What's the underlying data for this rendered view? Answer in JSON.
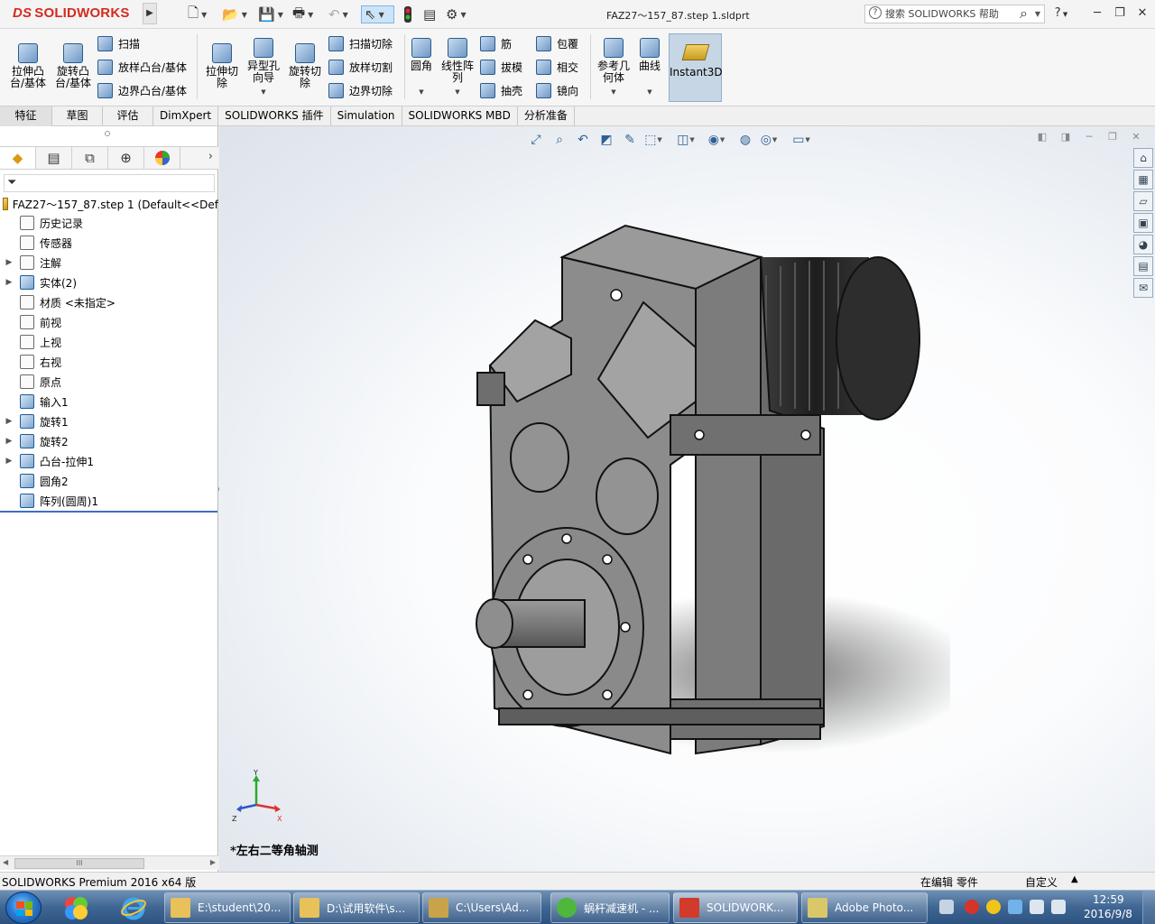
{
  "app": {
    "logo": "SOLIDWORKS",
    "logo_prefix": "DS",
    "document_title": "FAZ27～157_87.step 1.sldprt",
    "help_search_placeholder": "搜索 SOLIDWORKS 帮助",
    "help_label": "?",
    "window_buttons": {
      "minimize": "─",
      "restore": "❐",
      "close": "✕"
    }
  },
  "ribbon": {
    "big": [
      {
        "id": "extrude-boss",
        "label": "拉伸凸\n台/基体"
      },
      {
        "id": "revolve-boss",
        "label": "旋转凸\n台/基体"
      },
      {
        "id": "extrude-cut",
        "label": "拉伸切\n除"
      },
      {
        "id": "hole-wizard",
        "label": "异型孔\n向导"
      },
      {
        "id": "revolve-cut",
        "label": "旋转切\n除"
      },
      {
        "id": "fillet",
        "label": "圆角"
      },
      {
        "id": "linear-pattern",
        "label": "线性阵\n列"
      },
      {
        "id": "ref-geometry",
        "label": "参考几\n何体"
      },
      {
        "id": "curves",
        "label": "曲线"
      }
    ],
    "small": [
      {
        "id": "sweep",
        "label": "扫描"
      },
      {
        "id": "loft-boss",
        "label": "放样凸台/基体"
      },
      {
        "id": "boundary-boss",
        "label": "边界凸台/基体"
      },
      {
        "id": "swept-cut",
        "label": "扫描切除"
      },
      {
        "id": "lofted-cut",
        "label": "放样切割"
      },
      {
        "id": "boundary-cut",
        "label": "边界切除"
      },
      {
        "id": "rib",
        "label": "筋"
      },
      {
        "id": "draft",
        "label": "拔模"
      },
      {
        "id": "shell",
        "label": "抽壳"
      },
      {
        "id": "wrap",
        "label": "包覆"
      },
      {
        "id": "intersect",
        "label": "相交"
      },
      {
        "id": "mirror",
        "label": "镜向"
      }
    ],
    "instant3d": "Instant3D"
  },
  "cm_tabs": [
    "特征",
    "草图",
    "评估",
    "DimXpert",
    "SOLIDWORKS 插件",
    "Simulation",
    "SOLIDWORKS MBD",
    "分析准备"
  ],
  "feature_tree": {
    "root": "FAZ27～157_87.step 1  (Default<<Def",
    "items": [
      {
        "label": "历史记录",
        "expand": ""
      },
      {
        "label": "传感器",
        "expand": ""
      },
      {
        "label": "注解",
        "expand": "▶"
      },
      {
        "label": "实体(2)",
        "expand": "▶"
      },
      {
        "label": "材质 <未指定>",
        "expand": ""
      },
      {
        "label": "前视",
        "expand": ""
      },
      {
        "label": "上视",
        "expand": ""
      },
      {
        "label": "右视",
        "expand": ""
      },
      {
        "label": "原点",
        "expand": ""
      },
      {
        "label": "输入1",
        "expand": ""
      },
      {
        "label": "旋转1",
        "expand": "▶"
      },
      {
        "label": "旋转2",
        "expand": "▶"
      },
      {
        "label": "凸台-拉伸1",
        "expand": "▶"
      },
      {
        "label": "圆角2",
        "expand": ""
      },
      {
        "label": "阵列(圆周)1",
        "expand": ""
      }
    ],
    "scroll_label": "III"
  },
  "graphics": {
    "view_name": "*左右二等角轴测",
    "triad": {
      "x": "X",
      "y": "Y",
      "z": "Z"
    }
  },
  "status_bar": {
    "product": "SOLIDWORKS Premium 2016 x64 版",
    "editing": "在编辑 零件",
    "units": "自定义",
    "arrow": "▲"
  },
  "taskbar": {
    "buttons": [
      {
        "label": "E:\\student\\20...",
        "color": "#e8c15a"
      },
      {
        "label": "D:\\试用软件\\s...",
        "color": "#e8c15a"
      },
      {
        "label": "C:\\Users\\Ad...",
        "color": "#c9a34a"
      },
      {
        "label": "蜗杆减速机 - ...",
        "color": "#4db83b"
      },
      {
        "label": "SOLIDWORK...",
        "color": "#d23a2b"
      },
      {
        "label": "Adobe Photo...",
        "color": "#d9c86a"
      }
    ],
    "clock_time": "12:59",
    "clock_date": "2016/9/8"
  }
}
